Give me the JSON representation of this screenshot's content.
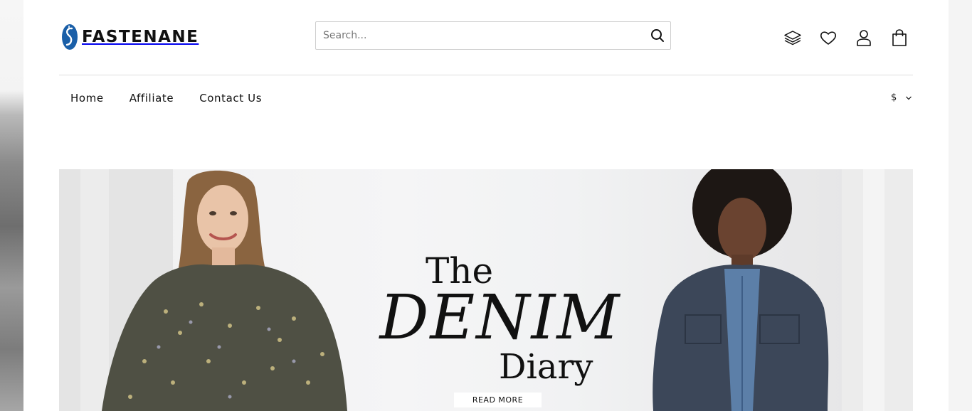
{
  "brand": {
    "name": "FASTENANE",
    "color": "#1a5fa8"
  },
  "search": {
    "placeholder": "Search..."
  },
  "header_icons": [
    "layers-icon",
    "heart-icon",
    "user-icon",
    "bag-icon"
  ],
  "nav": {
    "items": [
      {
        "label": "Home"
      },
      {
        "label": "Affiliate"
      },
      {
        "label": "Contact Us"
      }
    ]
  },
  "currency": {
    "selected": "$"
  },
  "hero": {
    "title_the": "The",
    "title_denim": "DENIM",
    "title_diary": "Diary",
    "cta_label": "READ MORE"
  }
}
